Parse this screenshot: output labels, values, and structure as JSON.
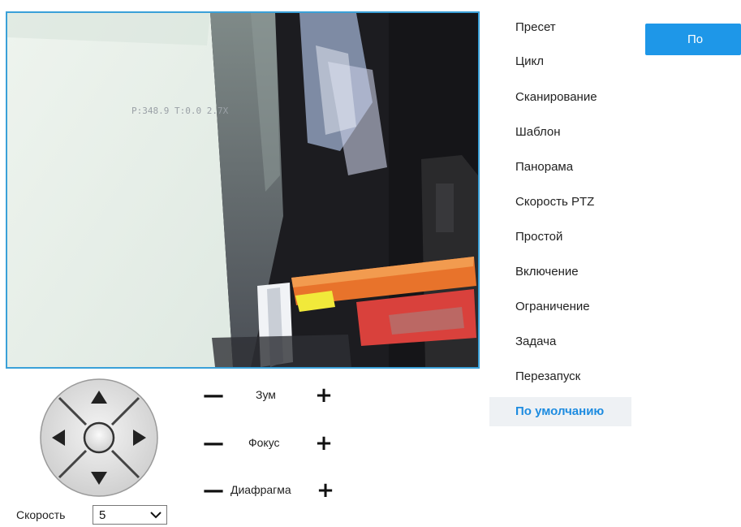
{
  "video": {
    "osd_text": "P:348.9 T:0.0 2.7X"
  },
  "ptz": {
    "zoom_label": "Зум",
    "focus_label": "Фокус",
    "iris_label": "Диафрагма",
    "minus_symbol": "—",
    "plus_symbol": "+",
    "speed_label": "Скорость",
    "speed_value": "5"
  },
  "menu": {
    "items": [
      {
        "label": "Пресет"
      },
      {
        "label": "Цикл"
      },
      {
        "label": "Сканирование"
      },
      {
        "label": "Шаблон"
      },
      {
        "label": "Панорама"
      },
      {
        "label": "Скорость PTZ"
      },
      {
        "label": "Простой"
      },
      {
        "label": "Включение"
      },
      {
        "label": "Ограничение"
      },
      {
        "label": "Задача"
      },
      {
        "label": "Перезапуск"
      },
      {
        "label": "По умолчанию"
      }
    ],
    "active_index": 11
  },
  "action_button": {
    "label": "По"
  },
  "colors": {
    "accent": "#1e97e8",
    "active_text": "#1e8ce0",
    "video_border": "#3aa0d8"
  }
}
